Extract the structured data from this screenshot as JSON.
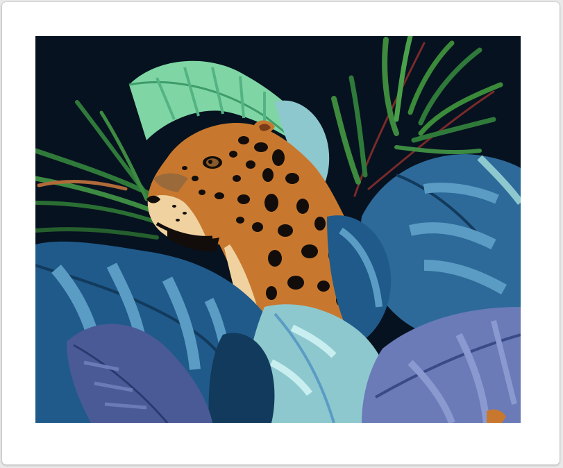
{
  "artwork": {
    "subject": "jaguar-in-tropical-leaves",
    "colors": {
      "background": "#06121f",
      "paper": "#ffffff",
      "jaguar_fur": "#c8782e",
      "jaguar_light": "#f0d2a0",
      "spots": "#120d0a",
      "monstera_blue": "#2d6a9a",
      "monstera_teal": "#8ec8cf",
      "monstera_dark": "#123a5c",
      "banana_green": "#7fd6a4",
      "palm_green": "#2f7a3a",
      "stem_red": "#7a2a2a",
      "purple_leaf": "#6a7bb8"
    }
  }
}
